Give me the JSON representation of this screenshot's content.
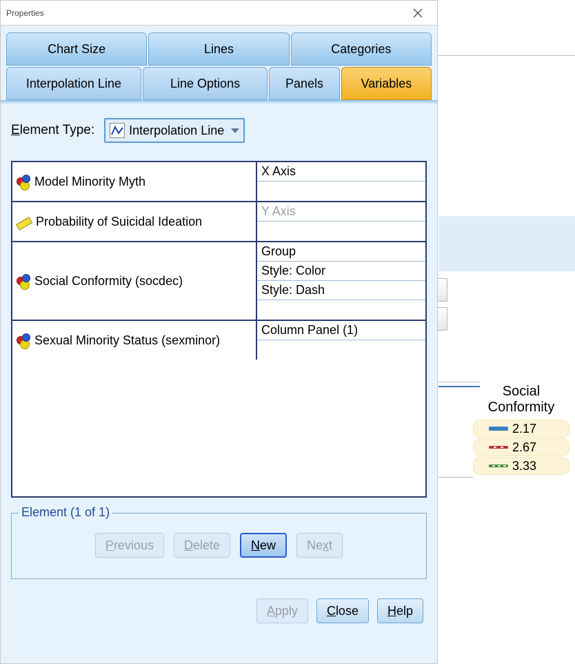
{
  "window": {
    "title": "Properties"
  },
  "tabs_row1": [
    {
      "label": "Chart Size"
    },
    {
      "label": "Lines"
    },
    {
      "label": "Categories"
    }
  ],
  "tabs_row2": [
    {
      "label": "Interpolation Line"
    },
    {
      "label": "Line Options"
    },
    {
      "label": "Panels"
    },
    {
      "label": "Variables",
      "active": true
    }
  ],
  "element_type": {
    "label": "Element Type:",
    "value": "Interpolation Line"
  },
  "variables_table": [
    {
      "name": "Model Minority Myth",
      "icon": "nominal",
      "assignments": [
        "X Axis",
        ""
      ]
    },
    {
      "name": "Probability of Suicidal Ideation",
      "icon": "scale",
      "assignments": [
        "Y Axis",
        ""
      ],
      "muted": true
    },
    {
      "name": "Social Conformity (socdec)",
      "icon": "nominal",
      "assignments": [
        "Group",
        "Style: Color",
        "Style: Dash",
        ""
      ]
    },
    {
      "name": "Sexual Minority Status (sexminor)",
      "icon": "nominal",
      "assignments": [
        "Column Panel (1)",
        ""
      ]
    }
  ],
  "element_group": {
    "legend": "Element (1 of 1)",
    "buttons": {
      "previous": "Previous",
      "delete": "Delete",
      "new": "New",
      "next": "Next"
    }
  },
  "bottom_buttons": {
    "apply": "Apply",
    "close": "Close",
    "help": "Help"
  },
  "background_legend": {
    "title_line1": "Social",
    "title_line2": "Conformity",
    "items": [
      {
        "value": "2.17",
        "color": "blue",
        "dash": "solid"
      },
      {
        "value": "2.67",
        "color": "red",
        "dash": "dashed"
      },
      {
        "value": "3.33",
        "color": "green",
        "dash": "dashed"
      }
    ]
  }
}
